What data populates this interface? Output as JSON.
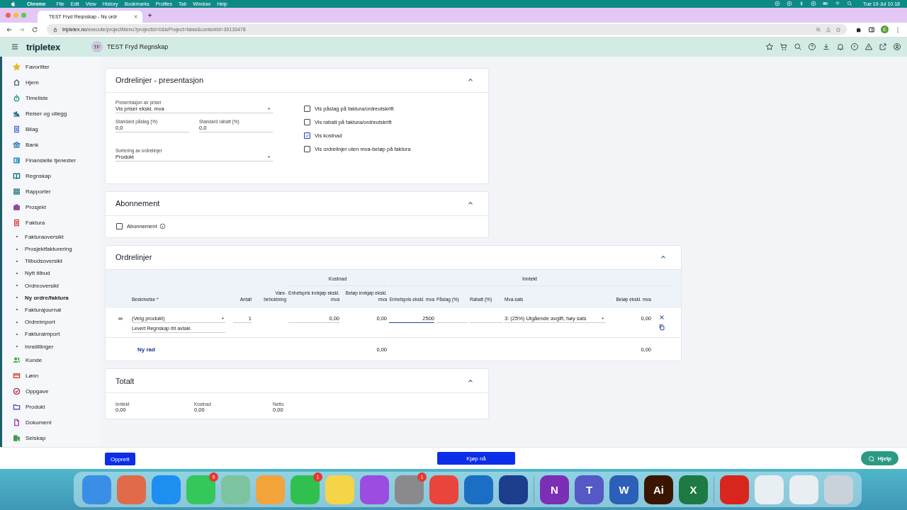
{
  "menubar": {
    "app": "Chrome",
    "menus": [
      "File",
      "Edit",
      "View",
      "History",
      "Bookmarks",
      "Profiles",
      "Tab",
      "Window",
      "Help"
    ],
    "clock": "Tue 19 Jul  10:18"
  },
  "browser": {
    "tabs": [
      {
        "title": "TEST Fryd Regnskap - Ny ordr",
        "selected": true
      }
    ],
    "url_host": "tripletex.no",
    "url_path": "/execute/projectMenu?projectId=0&isProject=false&contextId=39133478",
    "profile_initial": "E"
  },
  "header": {
    "logo": "tripletex",
    "company_initials": "TF",
    "company": "TEST Fryd Regnskap"
  },
  "sidebar": {
    "items": [
      {
        "label": "Favoritter",
        "kind": "main",
        "color": "#f0b323",
        "selected": false
      },
      {
        "label": "Hjem",
        "kind": "main",
        "color": "#4a6173",
        "selected": false
      },
      {
        "label": "Timeliste",
        "kind": "main",
        "color": "#2a9d8f",
        "selected": false
      },
      {
        "label": "Reiser og utlegg",
        "kind": "main",
        "color": "#1f5f8b",
        "selected": false
      },
      {
        "label": "Bilag",
        "kind": "main",
        "color": "#5b6ad0",
        "selected": false
      },
      {
        "label": "Bank",
        "kind": "main",
        "color": "#2f7fb8",
        "selected": false
      },
      {
        "label": "Finansielle tjenester",
        "kind": "main",
        "color": "#2b8cc4",
        "selected": false
      },
      {
        "label": "Regnskap",
        "kind": "main",
        "color": "#1c6e7d",
        "selected": false
      },
      {
        "label": "Rapporter",
        "kind": "main",
        "color": "#1f7a7a",
        "selected": false
      },
      {
        "label": "Prosjekt",
        "kind": "main",
        "color": "#8e44ad",
        "selected": false
      },
      {
        "label": "Faktura",
        "kind": "main",
        "color": "#d0443e",
        "selected": false
      },
      {
        "label": "Fakturaoversikt",
        "kind": "sub",
        "selected": false
      },
      {
        "label": "Prosjektfakturering",
        "kind": "sub",
        "selected": false
      },
      {
        "label": "Tilbudsoversikt",
        "kind": "sub",
        "selected": false
      },
      {
        "label": "Nytt tilbud",
        "kind": "sub",
        "selected": false
      },
      {
        "label": "Ordreoversikt",
        "kind": "sub",
        "selected": false
      },
      {
        "label": "Ny ordre/faktura",
        "kind": "sub",
        "selected": true
      },
      {
        "label": "Fakturajournal",
        "kind": "sub",
        "selected": false
      },
      {
        "label": "Ordreimport",
        "kind": "sub",
        "selected": false
      },
      {
        "label": "Fakturaimport",
        "kind": "sub",
        "selected": false
      },
      {
        "label": "Innstillinger",
        "kind": "sub",
        "selected": false
      },
      {
        "label": "Kunde",
        "kind": "main",
        "color": "#3aa845",
        "selected": false
      },
      {
        "label": "Lønn",
        "kind": "main",
        "color": "#d0503a",
        "selected": false
      },
      {
        "label": "Oppgave",
        "kind": "main",
        "color": "#b0305a",
        "selected": false
      },
      {
        "label": "Produkt",
        "kind": "main",
        "color": "#6a4fb0",
        "selected": false
      },
      {
        "label": "Dokument",
        "kind": "main",
        "color": "#9b3aa8",
        "selected": false
      },
      {
        "label": "Selskap",
        "kind": "main",
        "color": "#3a9a4a",
        "selected": false
      }
    ]
  },
  "presentation": {
    "title": "Ordrelinjer - presentasjon",
    "expanded": true,
    "price_display": {
      "label": "Presentasjon av priser",
      "value": "Vis priser ekskl. mva",
      "kind": "select"
    },
    "markup": {
      "label": "Standard påslag (%)",
      "value": "0,0"
    },
    "discount": {
      "label": "Standard rabatt (%)",
      "value": "0,0"
    },
    "sorting": {
      "label": "Sortering av ordrelinjer",
      "value": "Produkt",
      "kind": "select"
    },
    "options": [
      {
        "label": "Vis påslag på faktura/ordreutskrift",
        "checked": false
      },
      {
        "label": "Vis rabatt på faktura/ordreutskrift",
        "checked": false
      },
      {
        "label": "Vis kostnad",
        "checked": true
      },
      {
        "label": "Vis ordrelinjer uten mva-beløp på faktura",
        "checked": false
      }
    ]
  },
  "subscription": {
    "title": "Abonnement",
    "expanded": true,
    "checkbox": {
      "label": "Abonnement",
      "checked": false
    }
  },
  "order_lines": {
    "title": "Ordrelinjer",
    "expanded": true,
    "groups": [
      "Kostnad",
      "Inntekt"
    ],
    "columns": [
      "Beskrivelse *",
      "Antall",
      "Vare-beholdning",
      "Enhetspris innkjøp ekskl. mva",
      "Beløp innkjøp ekskl. mva",
      "Enhetspris ekskl. mva",
      "Påslag (%)",
      "Rabatt (%)",
      "Mva-sats",
      "Beløp ekskl. mva"
    ],
    "rows": [
      {
        "product": "(Velg produkt)",
        "description": "Levert Regnskap iht avtale.",
        "quantity": "1",
        "unit_cost": "0,00",
        "cost_amount": "0,00",
        "unit_price": "2500",
        "unit_price_focused": true,
        "vat": "3: (25%) Utgående avgift, høy sats",
        "amount": "0,00"
      }
    ],
    "new_row": "Ny rad",
    "cost_total": "0,00",
    "amount_total": "0,00"
  },
  "totals": {
    "title": "Totalt",
    "expanded": true,
    "items": [
      {
        "label": "Inntekt",
        "value": "0,00"
      },
      {
        "label": "Kostnad",
        "value": "0,00"
      },
      {
        "label": "Netto",
        "value": "0,00"
      }
    ]
  },
  "actions": {
    "create": "Opprett",
    "buy": "Kjøp nå",
    "help": "Hjelp"
  },
  "dock": {
    "apps": [
      {
        "kind": "app",
        "color": "#3a8ee6"
      },
      {
        "kind": "app",
        "color": "#e06a4a"
      },
      {
        "kind": "app",
        "color": "#1e8ef0"
      },
      {
        "kind": "app",
        "color": "#34c759",
        "badge": "9"
      },
      {
        "kind": "app",
        "color": "#7cc4a0"
      },
      {
        "kind": "app",
        "color": "#f2a33a"
      },
      {
        "kind": "app",
        "color": "#30c04f",
        "badge": "1"
      },
      {
        "kind": "app",
        "color": "#f5d547"
      },
      {
        "kind": "app",
        "color": "#9b4de0"
      },
      {
        "kind": "app",
        "color": "#8a8a8e",
        "badge": "1"
      },
      {
        "kind": "app",
        "color": "#e8453c"
      },
      {
        "kind": "app",
        "color": "#1a6fc4"
      },
      {
        "kind": "app",
        "color": "#1c3e8c"
      },
      {
        "kind": "separator"
      },
      {
        "kind": "app",
        "color": "#7b2fb5",
        "label": "N"
      },
      {
        "kind": "app",
        "color": "#5558c5",
        "label": "T"
      },
      {
        "kind": "app",
        "color": "#2b5fb8",
        "label": "W"
      },
      {
        "kind": "app",
        "color": "#3a1500",
        "label": "Ai"
      },
      {
        "kind": "app",
        "color": "#1d7a42",
        "label": "X"
      },
      {
        "kind": "separator"
      },
      {
        "kind": "app",
        "color": "#d9261c"
      },
      {
        "kind": "app",
        "color": "#e9eef3"
      },
      {
        "kind": "app",
        "color": "#e9eef3"
      },
      {
        "kind": "app",
        "color": "#c9d2da"
      }
    ]
  }
}
